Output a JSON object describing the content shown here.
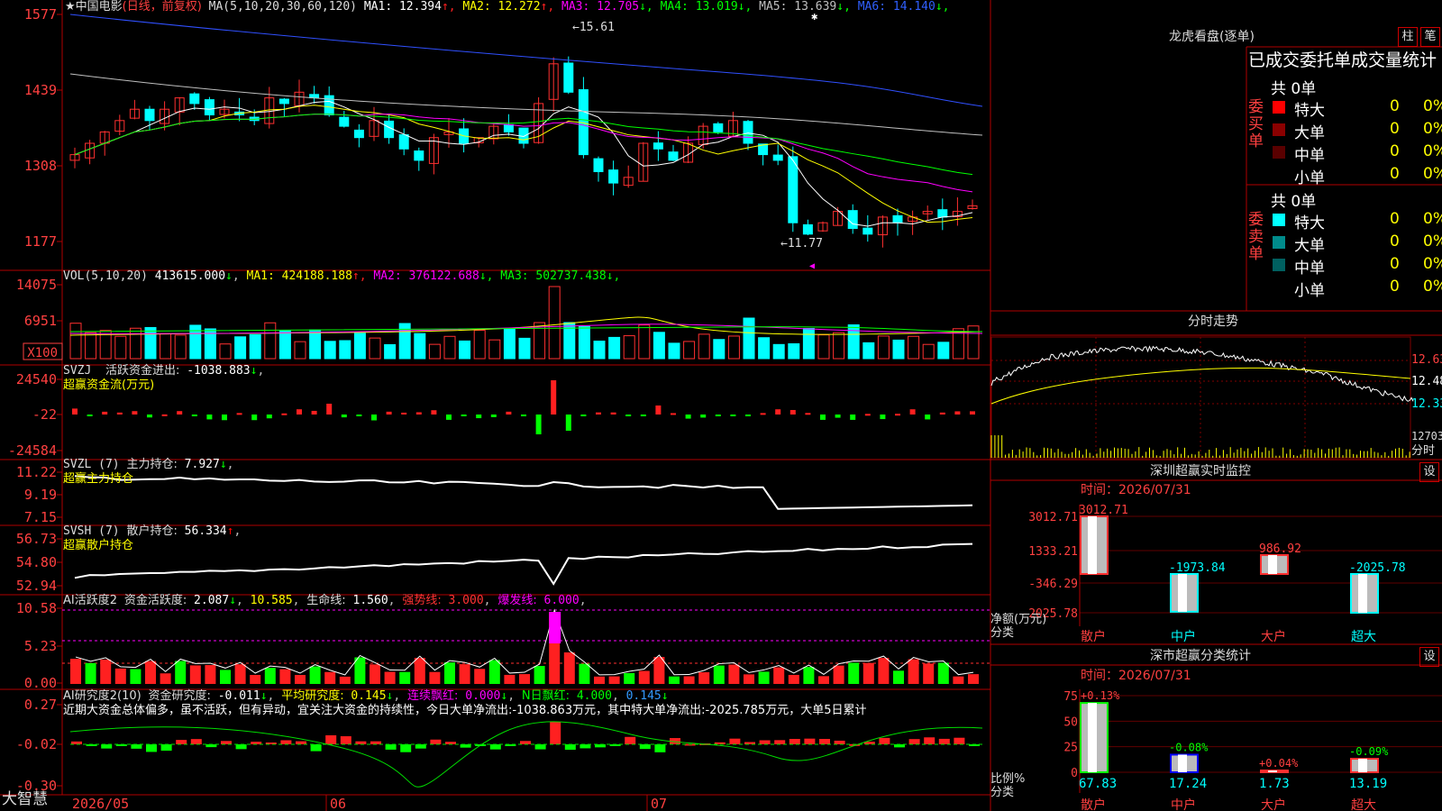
{
  "main": {
    "name": "★中国电影",
    "mode": "(日线，前复权)",
    "ma_title": "MA(5,10,20,30,60,120)",
    "ma": [
      {
        "label": "MA1:",
        "value": "12.394",
        "arrow": "↑",
        "color": "#ffffff"
      },
      {
        "label": "MA2:",
        "value": "12.272",
        "arrow": "↑",
        "color": "#ffff00"
      },
      {
        "label": "MA3:",
        "value": "12.705",
        "arrow": "↓",
        "color": "#ff00ff"
      },
      {
        "label": "MA4:",
        "value": "13.019",
        "arrow": "↓",
        "color": "#00ff00"
      },
      {
        "label": "MA5:",
        "value": "13.639",
        "arrow": "↓",
        "color": "#c0c0c0"
      },
      {
        "label": "MA6:",
        "value": "14.140",
        "arrow": "↓",
        "color": "#3060ff"
      }
    ],
    "y_ticks": [
      "1577",
      "1439",
      "1308",
      "1177"
    ],
    "high_label": "15.61",
    "low_label": "11.77"
  },
  "vol": {
    "title": "VOL(5,10,20)",
    "value": "413615.000",
    "ma": [
      {
        "label": "MA1:",
        "value": "424188.188",
        "arrow": "↑",
        "color": "#ffff00"
      },
      {
        "label": "MA2:",
        "value": "376122.688",
        "arrow": "↓",
        "color": "#ff00ff"
      },
      {
        "label": "MA3:",
        "value": "502737.438",
        "arrow": "↓",
        "color": "#00ff00"
      }
    ],
    "y_ticks": [
      "14075",
      "6951"
    ],
    "unit": "X100"
  },
  "svzj": {
    "title": "SVZJ",
    "label": "活跃资金进出:",
    "value": "-1038.883",
    "sub": "超赢资金流(万元)",
    "y_ticks": [
      "24540",
      "-22",
      "-24584"
    ]
  },
  "svzl": {
    "title": "SVZL (7)",
    "label": "主力持仓:",
    "value": "7.927",
    "sub": "超赢主力持仓",
    "y_ticks": [
      "11.22",
      "9.19",
      "7.15"
    ]
  },
  "svsh": {
    "title": "SVSH (7)",
    "label": "散户持仓:",
    "value": "56.334",
    "sub": "超赢散户持仓",
    "y_ticks": [
      "56.73",
      "54.80",
      "52.94"
    ]
  },
  "ai1": {
    "title": "AI活跃度2",
    "label": "资金活跃度:",
    "value": "2.087",
    "v2": "10.585",
    "l3": "生命线:",
    "v3": "1.560",
    "l4": "强势线:",
    "v4": "3.000",
    "l5": "爆发线:",
    "v5": "6.000",
    "y_ticks": [
      "10.58",
      "5.23",
      "0.00"
    ]
  },
  "ai2": {
    "title": "AI研究度2(10)",
    "label": "资金研究度:",
    "value": "-0.011",
    "l2": "平均研究度:",
    "v2": "0.145",
    "l3": "连续飘红:",
    "v3": "0.000",
    "l4": "N日飘红:",
    "v4": "4.000",
    "v5": "0.145",
    "text": "近期大资金总体偏多，虽不活跃，但有异动，宜关注大资金的持续性，今日大单净流出:-1038.863万元，其中特大单净流出:-2025.785万元，大单5日累计",
    "y_ticks": [
      "0.27",
      "-0.02",
      "-0.30"
    ]
  },
  "axis": {
    "x_labels": [
      "2026/05",
      "06",
      "07"
    ],
    "brand": "大智慧"
  },
  "lhb": {
    "title": "龙虎看盘(逐单)",
    "btn1": "柱",
    "btn2": "笔",
    "tabs": "已成交委托单成交量统计",
    "buy": {
      "side": "委买单",
      "total": "共 0单",
      "rows": [
        {
          "name": "特大",
          "count": "0",
          "pct": "0%",
          "color": "#ff0000"
        },
        {
          "name": "大单",
          "count": "0",
          "pct": "0%",
          "color": "#8b0000"
        },
        {
          "name": "中单",
          "count": "0",
          "pct": "0%",
          "color": "#5a0000"
        },
        {
          "name": "小单",
          "count": "0",
          "pct": "0%",
          "color": ""
        }
      ]
    },
    "sell": {
      "side": "委卖单",
      "total": "共 0单",
      "rows": [
        {
          "name": "特大",
          "count": "0",
          "pct": "0%",
          "color": "#00ffff"
        },
        {
          "name": "大单",
          "count": "0",
          "pct": "0%",
          "color": "#008b8b"
        },
        {
          "name": "中单",
          "count": "0",
          "pct": "0%",
          "color": "#006060"
        },
        {
          "name": "小单",
          "count": "0",
          "pct": "0%",
          "color": ""
        }
      ]
    }
  },
  "fenshi": {
    "title": "分时走势",
    "y_ticks": [
      "12.63",
      "12.48",
      "12.33"
    ],
    "vol_tick": "12703",
    "vol_unit": "分时"
  },
  "monitor": {
    "title": "深圳超赢实时监控",
    "btn": "设",
    "time": "时间：2026/07/31",
    "y_ticks": [
      "3012.71",
      "1333.21",
      "-346.29",
      "-2025.78"
    ],
    "ylabel": "净额(万元)",
    "xlabel": "分类",
    "chart_data": {
      "type": "bar",
      "categories": [
        "散户",
        "中户",
        "大户",
        "超大"
      ],
      "values": [
        3012.71,
        -1973.84,
        986.92,
        -2025.78
      ],
      "labels": [
        "3012.71",
        "-1973.84",
        "986.92",
        "-2025.78"
      ],
      "ylim": [
        -2025.78,
        3012.71
      ],
      "ylabel": "净额(万元)",
      "xlabel": "分类"
    }
  },
  "classify": {
    "title": "深市超赢分类统计",
    "btn": "设",
    "time": "时间：2026/07/31",
    "y_ticks": [
      "75",
      "50",
      "25",
      "0"
    ],
    "ylabel": "比例%",
    "xlabel": "分类",
    "chart_data": {
      "type": "bar",
      "categories": [
        "散户",
        "中户",
        "大户",
        "超大"
      ],
      "values": [
        67.83,
        17.24,
        1.73,
        13.19
      ],
      "changes": [
        "+0.13%",
        "-0.08%",
        "+0.04%",
        "-0.09%"
      ],
      "ylim": [
        0,
        75
      ],
      "ylabel": "比例%",
      "xlabel": "分类"
    }
  }
}
